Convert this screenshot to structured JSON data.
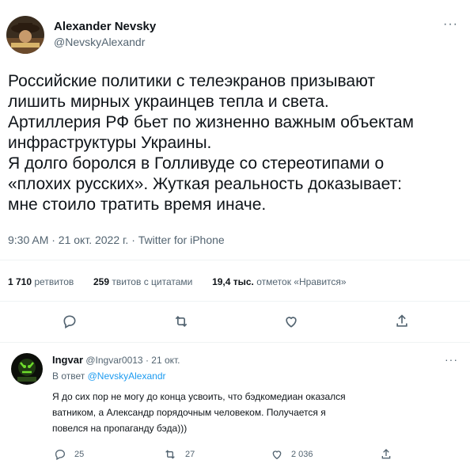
{
  "tweet": {
    "author_name": "Alexander Nevsky",
    "author_handle": "@NevskyAlexandr",
    "text_lines": [
      "Российские политики с телеэкранов призывают",
      "лишить мирных украинцев тепла и света.",
      "Артиллерия РФ бьет по жизненно важным объектам",
      "инфраструктуры Украины.",
      "Я долго боролся в Голливуде со стереотипами о",
      "«плохих русских». Жуткая реальность доказывает:",
      "мне стоило тратить время иначе."
    ],
    "meta": "9:30 AM · 21 окт. 2022 г. · Twitter for iPhone",
    "stats": {
      "retweets_count": "1 710",
      "retweets_label": "ретвитов",
      "quotes_count": "259",
      "quotes_label": "твитов с цитатами",
      "likes_count": "19,4 тыс.",
      "likes_label": "отметок «Нравится»"
    },
    "more_icon": "more-dots-icon"
  },
  "reply": {
    "author_name": "Ingvar",
    "author_handle": "@Ingvar0013",
    "date": "· 21 окт.",
    "in_reply_prefix": "В ответ",
    "in_reply_to": "@NevskyAlexandr",
    "text_lines": [
      "Я до сих пор не могу до конца усвоить, что бэдкомедиан оказался",
      "ватником, а Александр порядочным человеком. Получается я",
      "повелся на пропаганду бэда)))"
    ],
    "reply_count": "25",
    "retweet_count": "27",
    "like_count": "2 036"
  },
  "colors": {
    "text": "#0f1419",
    "muted": "#536471",
    "accent": "#1d9bf0",
    "divider": "#eff3f4"
  }
}
